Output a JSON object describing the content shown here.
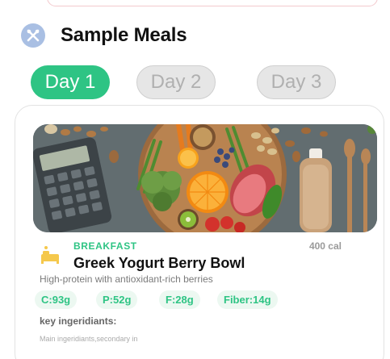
{
  "section": {
    "title": "Sample Meals",
    "icon": "utensils-icon"
  },
  "days": {
    "tabs": [
      {
        "label": "Day 1",
        "active": true
      },
      {
        "label": "Day 2",
        "active": false
      },
      {
        "label": "Day 3",
        "active": false
      }
    ]
  },
  "meal": {
    "type": "BREAKFAST",
    "calories": "400 cal",
    "name": "Greek Yogurt Berry Bowl",
    "description": "High-protein with antioxidant-rich berries",
    "macros": [
      {
        "label": "C:93g"
      },
      {
        "label": "P:52g"
      },
      {
        "label": "F:28g"
      },
      {
        "label": "Fiber:14g"
      }
    ],
    "ingredients_label": "key ingeridiants:",
    "ingredients_text": "Main ingeridiants,secondary in",
    "image_icon": "meal-photo",
    "type_icon": "breakfast-icon"
  },
  "colors": {
    "accent": "#2ec484",
    "header_icon_bg": "#a9bfe3",
    "chip_bg": "#ecf8f1",
    "inactive_tab_bg": "#e6e6e6"
  }
}
